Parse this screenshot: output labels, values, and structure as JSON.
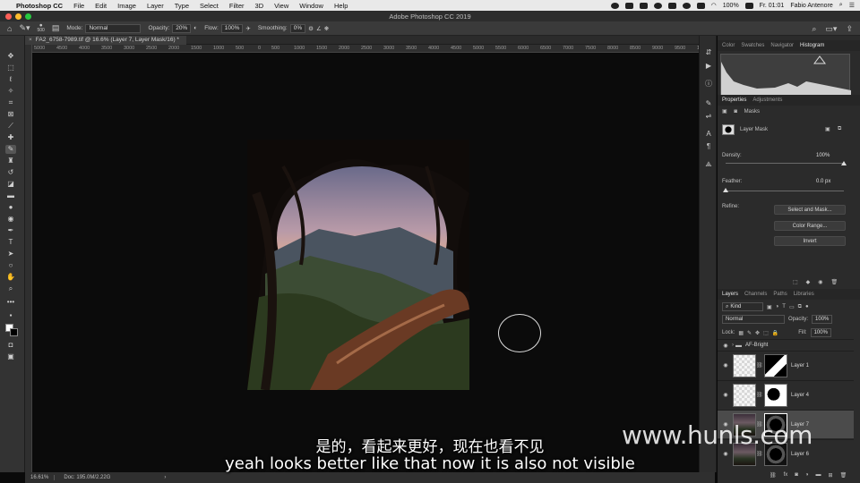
{
  "menubar": {
    "app": "Photoshop CC",
    "items": [
      "File",
      "Edit",
      "Image",
      "Layer",
      "Type",
      "Select",
      "Filter",
      "3D",
      "View",
      "Window",
      "Help"
    ],
    "battery": "100%",
    "clock": "Fr. 01:01",
    "user": "Fabio Antenore"
  },
  "window": {
    "title": "Adobe Photoshop CC 2019"
  },
  "options_bar": {
    "brush_size": "500",
    "mode_label": "Mode:",
    "mode_value": "Normal",
    "opacity_label": "Opacity:",
    "opacity_value": "20%",
    "flow_label": "Flow:",
    "flow_value": "100%",
    "smoothing_label": "Smoothing:",
    "smoothing_value": "0%"
  },
  "document": {
    "tab_title": "FA2_6758-7989.tif @ 16.6% (Layer 7, Layer Mask/16) *",
    "ruler_ticks": [
      "5000",
      "4500",
      "4000",
      "3500",
      "3000",
      "2500",
      "2000",
      "1500",
      "1000",
      "500",
      "0",
      "500",
      "1000",
      "1500",
      "2000",
      "2500",
      "3000",
      "3500",
      "4000",
      "4500",
      "5000",
      "5500",
      "6000",
      "6500",
      "7000",
      "7500",
      "8000",
      "8500",
      "9000",
      "9500",
      "1000"
    ]
  },
  "status_bar": {
    "zoom": "16.61%",
    "doc": "Doc: 195.0M/2.22G"
  },
  "panels": {
    "top_tabs": [
      "Color",
      "Swatches",
      "Navigator",
      "Histogram"
    ],
    "properties_tabs": [
      "Properties",
      "Adjustments"
    ],
    "masks_label": "Masks",
    "layer_mask_label": "Layer Mask",
    "density_label": "Density:",
    "density_value": "100%",
    "feather_label": "Feather:",
    "feather_value": "0.0 px",
    "refine_label": "Refine:",
    "select_and_mask": "Select and Mask...",
    "color_range": "Color Range...",
    "invert": "Invert",
    "layers_tabs": [
      "Layers",
      "Channels",
      "Paths",
      "Libraries"
    ],
    "kind_filter": "Kind",
    "blend_mode": "Normal",
    "opacity_label": "Opacity:",
    "opacity_value": "100%",
    "lock_label": "Lock:",
    "fill_label": "Fill:",
    "fill_value": "100%",
    "group_name": "AF-Bright",
    "layers": [
      {
        "name": "Layer 1"
      },
      {
        "name": "Layer 4"
      },
      {
        "name": "Layer 7"
      },
      {
        "name": "Layer 6"
      }
    ],
    "layers_footer": "fx"
  },
  "subtitles": {
    "chinese": "是的，看起来更好，现在也看不见",
    "english": "yeah looks better like that now it is also not visible"
  },
  "watermark": "www.hunls.com"
}
